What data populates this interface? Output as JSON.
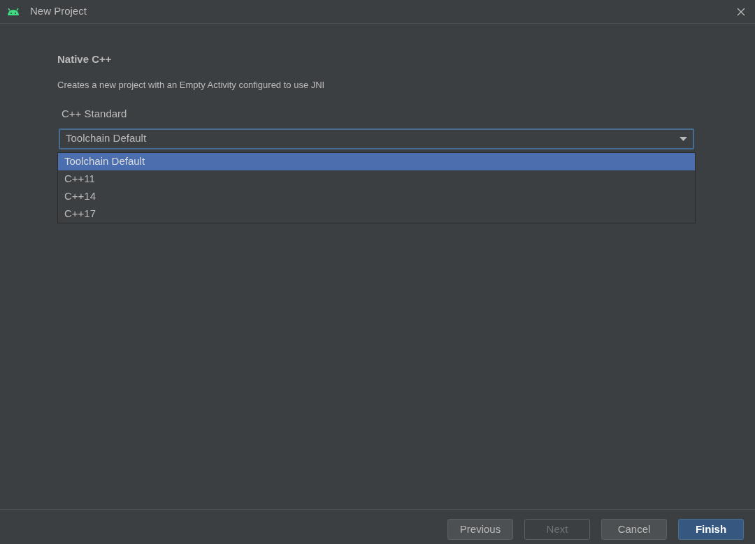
{
  "window": {
    "title": "New Project"
  },
  "heading": "Native C++",
  "description": "Creates a new project with an Empty Activity configured to use JNI",
  "cpp_standard": {
    "label": "C++ Standard",
    "value": "Toolchain Default",
    "expanded": true,
    "options": [
      {
        "label": "Toolchain Default",
        "selected": true
      },
      {
        "label": "C++11",
        "selected": false
      },
      {
        "label": "C++14",
        "selected": false
      },
      {
        "label": "C++17",
        "selected": false
      }
    ]
  },
  "buttons": [
    {
      "label": "Previous",
      "kind": "default",
      "disabled": false
    },
    {
      "label": "Next",
      "kind": "default",
      "disabled": true
    },
    {
      "label": "Cancel",
      "kind": "default",
      "disabled": false
    },
    {
      "label": "Finish",
      "kind": "primary",
      "disabled": false
    }
  ]
}
